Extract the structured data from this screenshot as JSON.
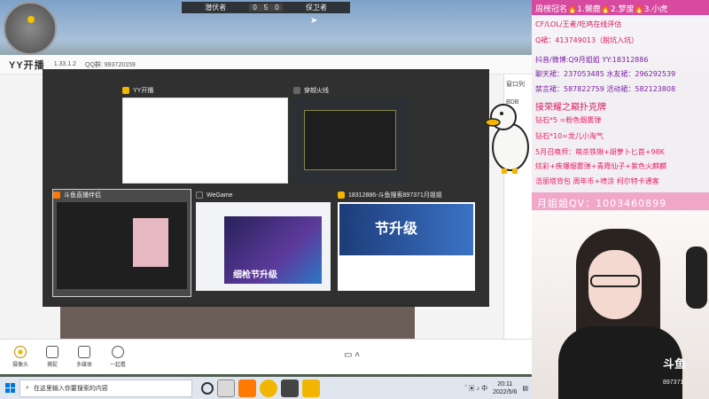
{
  "game": {
    "team_left": "潜伏者",
    "score_left": "0",
    "score_mid": "5",
    "score_right": "0",
    "team_right": "保卫者"
  },
  "yy": {
    "logo": "YY开播",
    "version": "1.33.1.2",
    "qq": "QQ群: 993720159",
    "side_label": "窗口列",
    "side_label2": "BDB",
    "tools": [
      {
        "label": "摄像头",
        "icon": "camera-icon"
      },
      {
        "label": "捕捉",
        "icon": "capture-icon"
      },
      {
        "label": "多媒体",
        "icon": "media-icon"
      },
      {
        "label": "一起看",
        "icon": "watch-together-icon"
      }
    ]
  },
  "picker": {
    "windows": [
      {
        "title": "YY开播",
        "icon_color": "#f2b600"
      },
      {
        "title": "穿越火线",
        "icon_color": "#666666"
      },
      {
        "title": "斗鱼直播伴侣",
        "icon_color": "#ff7a00"
      },
      {
        "title": "WeGame",
        "icon_color": "#333333"
      },
      {
        "title": "18312886-斗鱼搜索897371月姐姐",
        "icon_color": "#f2b600"
      }
    ],
    "t5_banner_text": "节升级",
    "t4_banner_text": "细枪节升级"
  },
  "right_panel": {
    "title": "周榜冠名🔥1.懒鹿🔥2.梦废🔥3.小虎",
    "lines": [
      {
        "text": "CF/LOL/王者/吃鸡在线评估",
        "color": "#d81b60"
      },
      {
        "text": "Q裙：413749013（脱坑入坑）",
        "color": "#d81b60"
      },
      {
        "text": "抖音/微博:Q9月姐姐    YY:18312886",
        "color": "#7b1fa2"
      },
      {
        "text": "聊天裙：237053485  水友裙：296292539",
        "color": "#7b1fa2"
      },
      {
        "text": "禁言裙：587822759  活动裙：582123808",
        "color": "#7b1fa2"
      },
      {
        "text": "接荣耀之巅扑克牌",
        "color": "#d81b60"
      },
      {
        "text": "钻石*5 =粉色烟雾弹",
        "color": "#e91e63"
      },
      {
        "text": "钻石*10=龙儿小淘气",
        "color": "#e91e63"
      },
      {
        "text": "5月召唤师：萌杀铁锹+胡萝卜匕首+98K",
        "color": "#e91e63"
      },
      {
        "text": "炫彩+疾爆烟雾弹+青霞仙子+紫色火麒麟",
        "color": "#e91e63"
      },
      {
        "text": "浩丽塔背包 周年币+喷涂 柯尔特卡通客",
        "color": "#e91e63"
      }
    ],
    "bottom_bar": "月姐姐QV：1003460899"
  },
  "stream": {
    "logo": "斗鱼",
    "room_id": "897371"
  },
  "taskbar": {
    "search_placeholder": "在这里输入你要搜索的内容",
    "time": "20:11",
    "date": "2022/5/6"
  }
}
